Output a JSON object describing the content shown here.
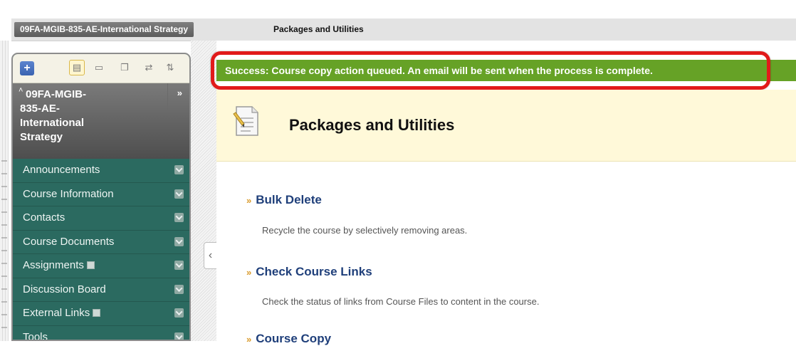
{
  "breadcrumb": {
    "course": "09FA-MGIB-835-AE-International Strategy",
    "current": "Packages and Utilities"
  },
  "nav": {
    "toolbar": {
      "add_icon": "plus-icon",
      "icons": [
        "list-view-icon",
        "folder-view-icon",
        "window-icon",
        "refresh-icon",
        "sort-icon"
      ]
    },
    "course_title": "09FA-MGIB-835-AE-International Strategy",
    "course_title_lines": [
      "09FA-MGIB-",
      "835-AE-",
      "International",
      "Strategy"
    ],
    "items": [
      {
        "label": "Announcements"
      },
      {
        "label": "Course Information"
      },
      {
        "label": "Contacts"
      },
      {
        "label": "Course Documents"
      },
      {
        "label": "Assignments"
      },
      {
        "label": "Discussion Board"
      },
      {
        "label": "External Links"
      },
      {
        "label": "Tools"
      }
    ]
  },
  "notice": {
    "text": "Success: Course copy action queued. An email will be sent when the process is complete.",
    "color": "#66a226"
  },
  "page": {
    "title": "Packages and Utilities"
  },
  "tools": [
    {
      "name": "Bulk Delete",
      "description": "Recycle the course by selectively removing areas."
    },
    {
      "name": "Check Course Links",
      "description": "Check the status of links from Course Files to content in the course."
    },
    {
      "name": "Course Copy",
      "description": ""
    }
  ],
  "colors": {
    "nav_bg": "#2b6a60",
    "highlight_ring": "#e11a1a",
    "title_bg": "#fff9d9",
    "link": "#1f3f7a"
  }
}
